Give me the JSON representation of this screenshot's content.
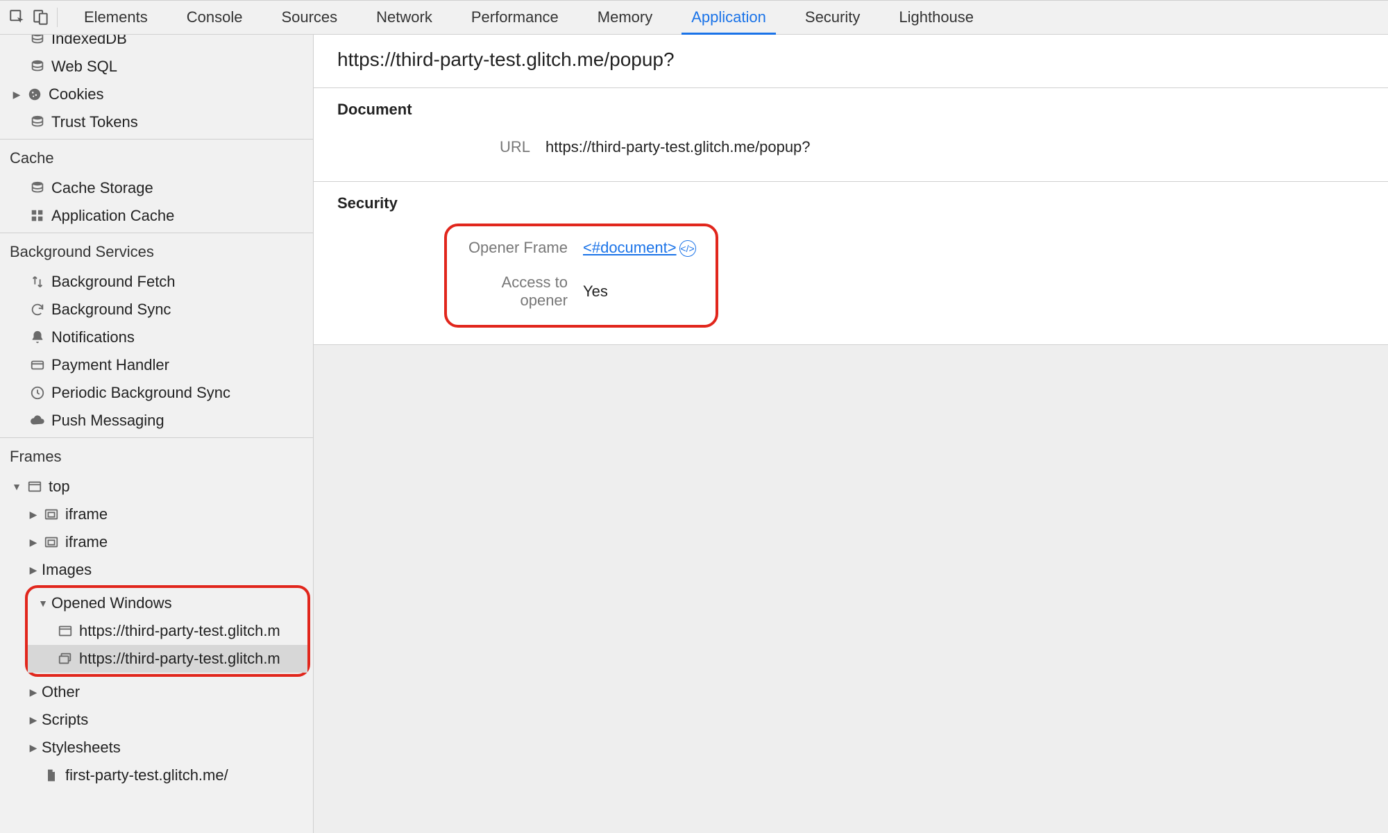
{
  "tabs": {
    "elements": "Elements",
    "console": "Console",
    "sources": "Sources",
    "network": "Network",
    "performance": "Performance",
    "memory": "Memory",
    "application": "Application",
    "security": "Security",
    "lighthouse": "Lighthouse"
  },
  "sidebar": {
    "storage": {
      "indexeddb": "IndexedDB",
      "websql": "Web SQL",
      "cookies": "Cookies",
      "trust_tokens": "Trust Tokens"
    },
    "cache_heading": "Cache",
    "cache": {
      "cache_storage": "Cache Storage",
      "application_cache": "Application Cache"
    },
    "bg_heading": "Background Services",
    "bg": {
      "fetch": "Background Fetch",
      "sync": "Background Sync",
      "notifications": "Notifications",
      "payment": "Payment Handler",
      "periodic": "Periodic Background Sync",
      "push": "Push Messaging"
    },
    "frames_heading": "Frames",
    "frames": {
      "top": "top",
      "iframe1": "iframe",
      "iframe2": "iframe",
      "images": "Images",
      "opened_windows": "Opened Windows",
      "ow1": "https://third-party-test.glitch.m",
      "ow2": "https://third-party-test.glitch.m",
      "other": "Other",
      "scripts": "Scripts",
      "stylesheets": "Stylesheets",
      "leaf": "first-party-test.glitch.me/"
    }
  },
  "detail": {
    "title": "https://third-party-test.glitch.me/popup?",
    "section_document": "Document",
    "url_label": "URL",
    "url_value": "https://third-party-test.glitch.me/popup?",
    "section_security": "Security",
    "opener_frame_label": "Opener Frame",
    "opener_frame_value": "<#document>",
    "access_label": "Access to opener",
    "access_value": "Yes"
  }
}
